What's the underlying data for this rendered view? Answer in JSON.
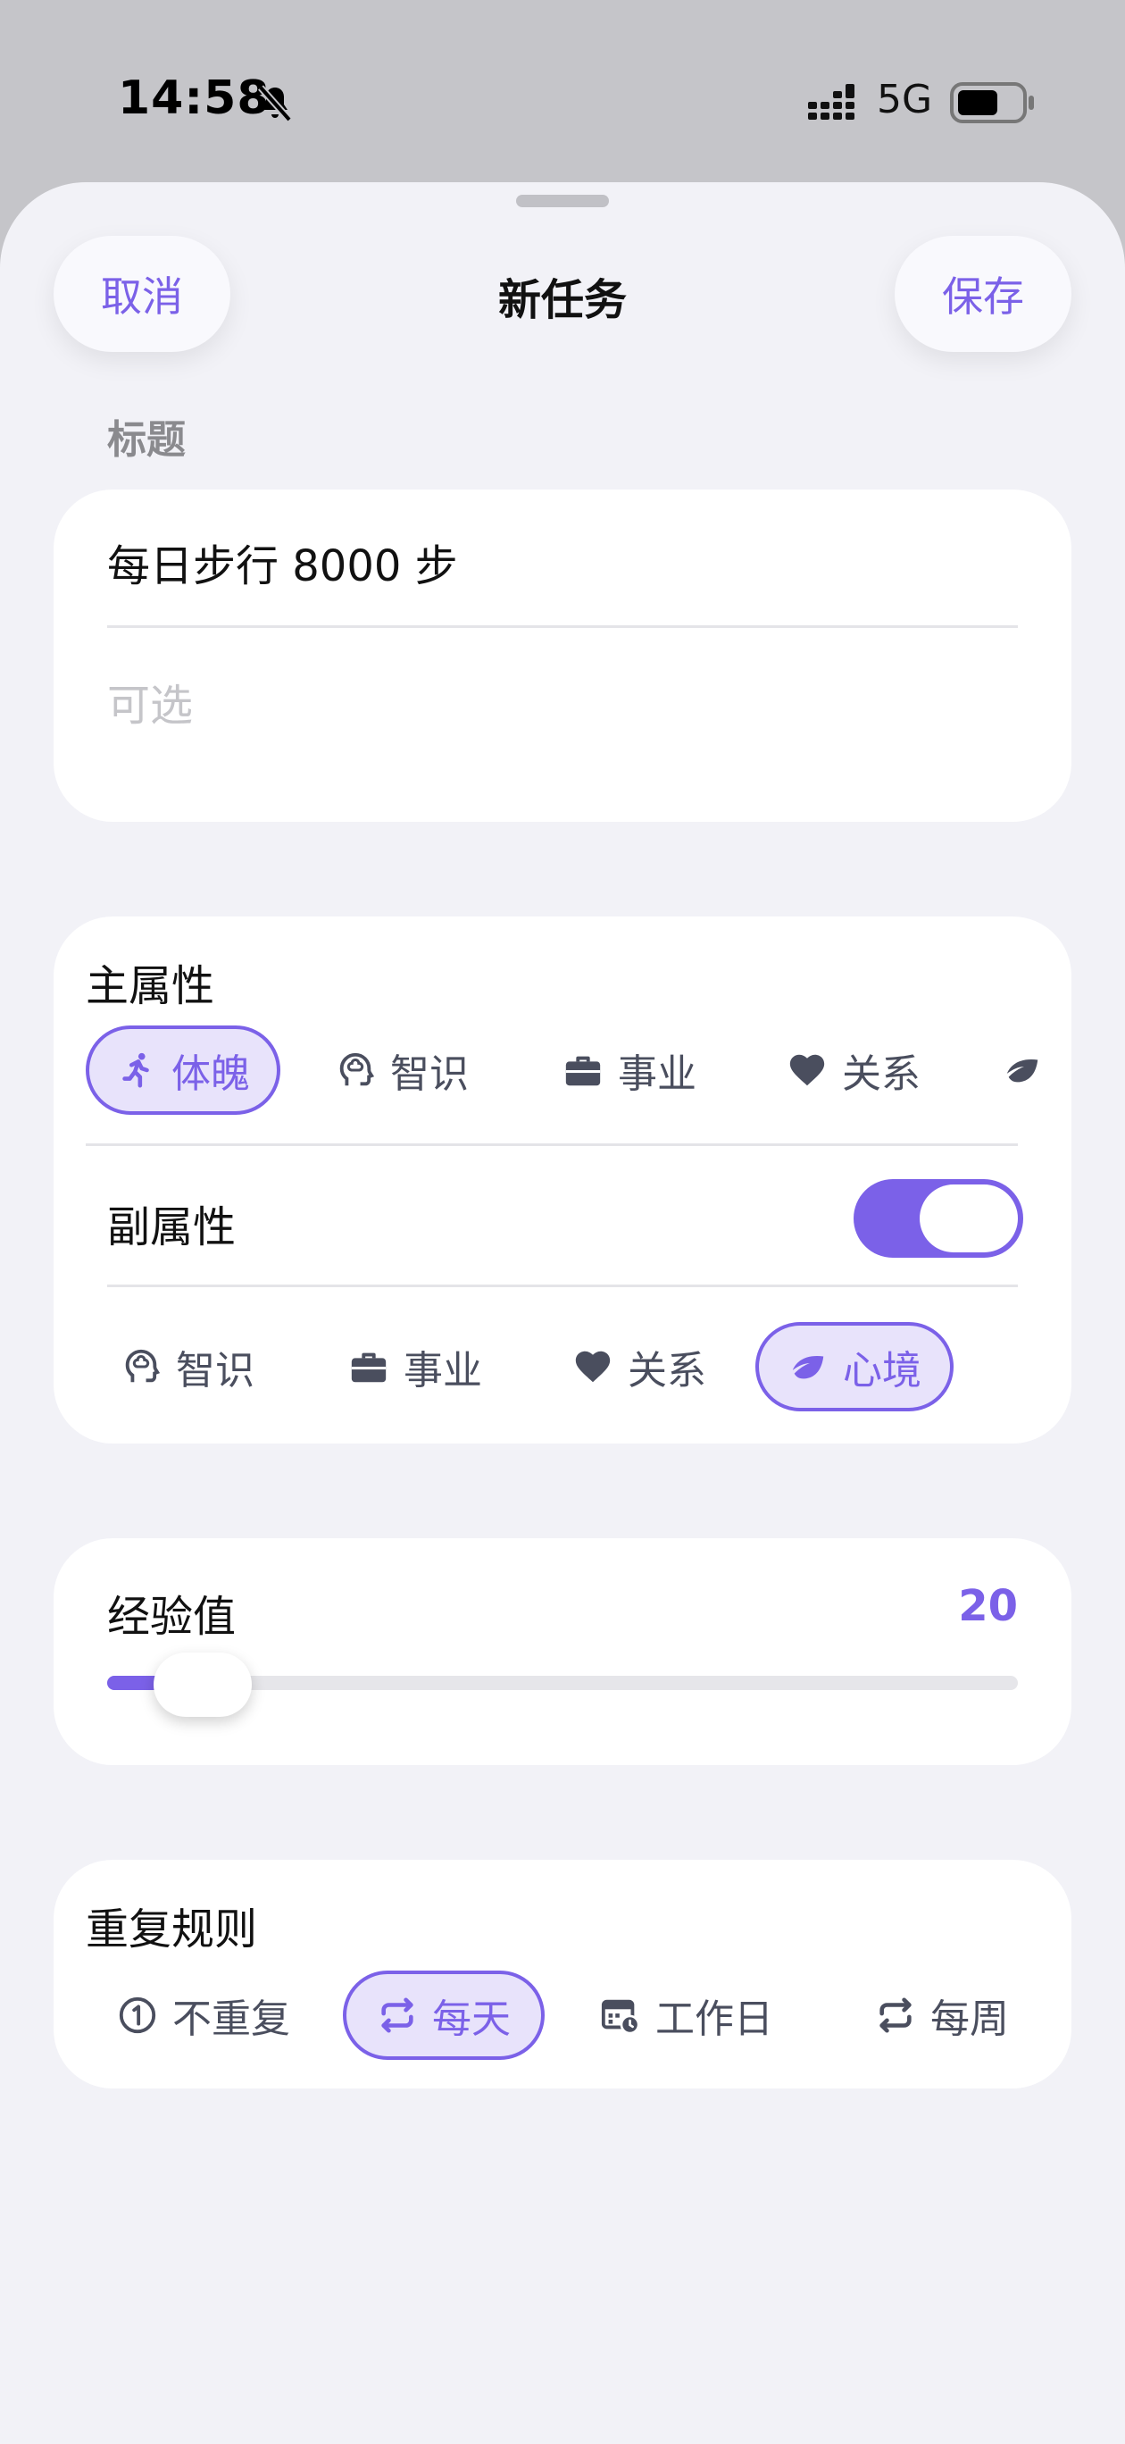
{
  "status_bar": {
    "time": "14:58",
    "network": "5G"
  },
  "header": {
    "cancel_label": "取消",
    "title": "新任务",
    "save_label": "保存"
  },
  "title_section": {
    "label": "标题",
    "title_value": "每日步行 8000 步",
    "notes_placeholder": "可选"
  },
  "primary_attribute": {
    "heading": "主属性",
    "options": [
      {
        "label": "体魄",
        "icon": "running-icon",
        "selected": true
      },
      {
        "label": "智识",
        "icon": "brain-head-icon",
        "selected": false
      },
      {
        "label": "事业",
        "icon": "briefcase-icon",
        "selected": false
      },
      {
        "label": "关系",
        "icon": "heart-icon",
        "selected": false
      },
      {
        "label": "心境",
        "icon": "leaf-icon",
        "selected": false
      }
    ]
  },
  "secondary_attribute": {
    "heading": "副属性",
    "enabled": true,
    "options": [
      {
        "label": "智识",
        "icon": "brain-head-icon",
        "selected": false
      },
      {
        "label": "事业",
        "icon": "briefcase-icon",
        "selected": false
      },
      {
        "label": "关系",
        "icon": "heart-icon",
        "selected": false
      },
      {
        "label": "心境",
        "icon": "leaf-icon",
        "selected": true
      }
    ]
  },
  "experience": {
    "heading": "经验值",
    "value": "20",
    "slider_fraction": 0.06
  },
  "repeat_rule": {
    "heading": "重复规则",
    "options": [
      {
        "label": "不重复",
        "icon": "one-circle-icon",
        "selected": false
      },
      {
        "label": "每天",
        "icon": "repeat-icon",
        "selected": true
      },
      {
        "label": "工作日",
        "icon": "calendar-clock-icon",
        "selected": false
      },
      {
        "label": "每周",
        "icon": "repeat-icon",
        "selected": false
      }
    ]
  },
  "colors": {
    "accent": "#7b61e8",
    "accent_tint": "#e8e3fb",
    "background": "#f2f2f7",
    "card": "#ffffff"
  }
}
